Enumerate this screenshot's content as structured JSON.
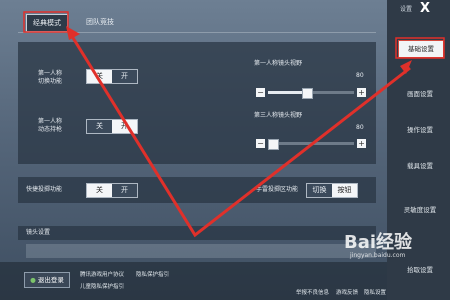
{
  "tabs": [
    {
      "label": "经典模式"
    },
    {
      "label": "团队竞技"
    }
  ],
  "settings": {
    "first_person_switch": {
      "label": "第一人称\n切换功能",
      "options": [
        "关",
        "开"
      ],
      "selected": 0
    },
    "first_person_dynamic": {
      "label": "第一人称\n动态持枪",
      "options": [
        "关",
        "开"
      ],
      "selected": 1
    },
    "fpp_fov": {
      "label": "第一人称镜头视野",
      "value": "80"
    },
    "tpp_fov": {
      "label": "第三人称镜头视野",
      "value": "80"
    },
    "quick_throw": {
      "label": "快捷投掷功能",
      "options": [
        "关",
        "开"
      ],
      "selected": 0
    },
    "throw_area": {
      "label": "手雷投掷区功能",
      "options": [
        "切换",
        "按钮"
      ],
      "selected": 1
    },
    "section_lens": {
      "label": "镜头设置"
    }
  },
  "sidebar": {
    "title": "设置",
    "close": "X",
    "items": [
      {
        "label": "基础设置"
      },
      {
        "label": "画面设置"
      },
      {
        "label": "操作设置"
      },
      {
        "label": "载具设置"
      },
      {
        "label": "灵敏度设置"
      },
      {
        "label": "拾取设置"
      }
    ]
  },
  "bottom": {
    "logout": "退出登录",
    "links": [
      "腾讯游戏用户协议",
      "儿童隐私保护指引",
      "隐私保护指引"
    ],
    "actions": [
      "举报不良信息",
      "游戏反馈",
      "隐私设置"
    ]
  },
  "watermark": {
    "text": "Bai经验",
    "sub": "jingyan.baidu.com"
  }
}
